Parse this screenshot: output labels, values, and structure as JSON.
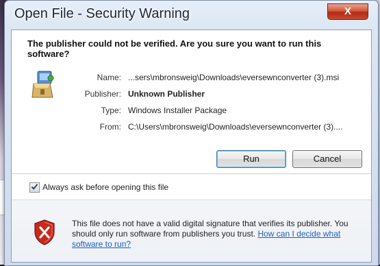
{
  "window": {
    "title": "Open File - Security Warning",
    "close_glyph": "X"
  },
  "heading": "The publisher could not be verified.  Are you sure you want to run this software?",
  "fields": {
    "name_label": "Name:",
    "name_value": "...sers\\mbronsweig\\Downloads\\eversewnconverter (3).msi",
    "publisher_label": "Publisher:",
    "publisher_value": "Unknown Publisher",
    "type_label": "Type:",
    "type_value": "Windows Installer Package",
    "from_label": "From:",
    "from_value": "C:\\Users\\mbronsweig\\Downloads\\eversewnconverter (3)...."
  },
  "buttons": {
    "run": "Run",
    "cancel": "Cancel"
  },
  "checkbox": {
    "label": "Always ask before opening this file",
    "checked": true
  },
  "warning": {
    "text": "This file does not have a valid digital signature that verifies its publisher. You should only run software from publishers you trust.",
    "link": "How can I decide what software to run?"
  },
  "icons": {
    "package": "installer-package-icon",
    "shield": "security-shield-icon",
    "check": "checkmark-icon"
  },
  "colors": {
    "link": "#1f5fbf",
    "close_button": "#c64a2f",
    "shield_red": "#c8281e"
  }
}
